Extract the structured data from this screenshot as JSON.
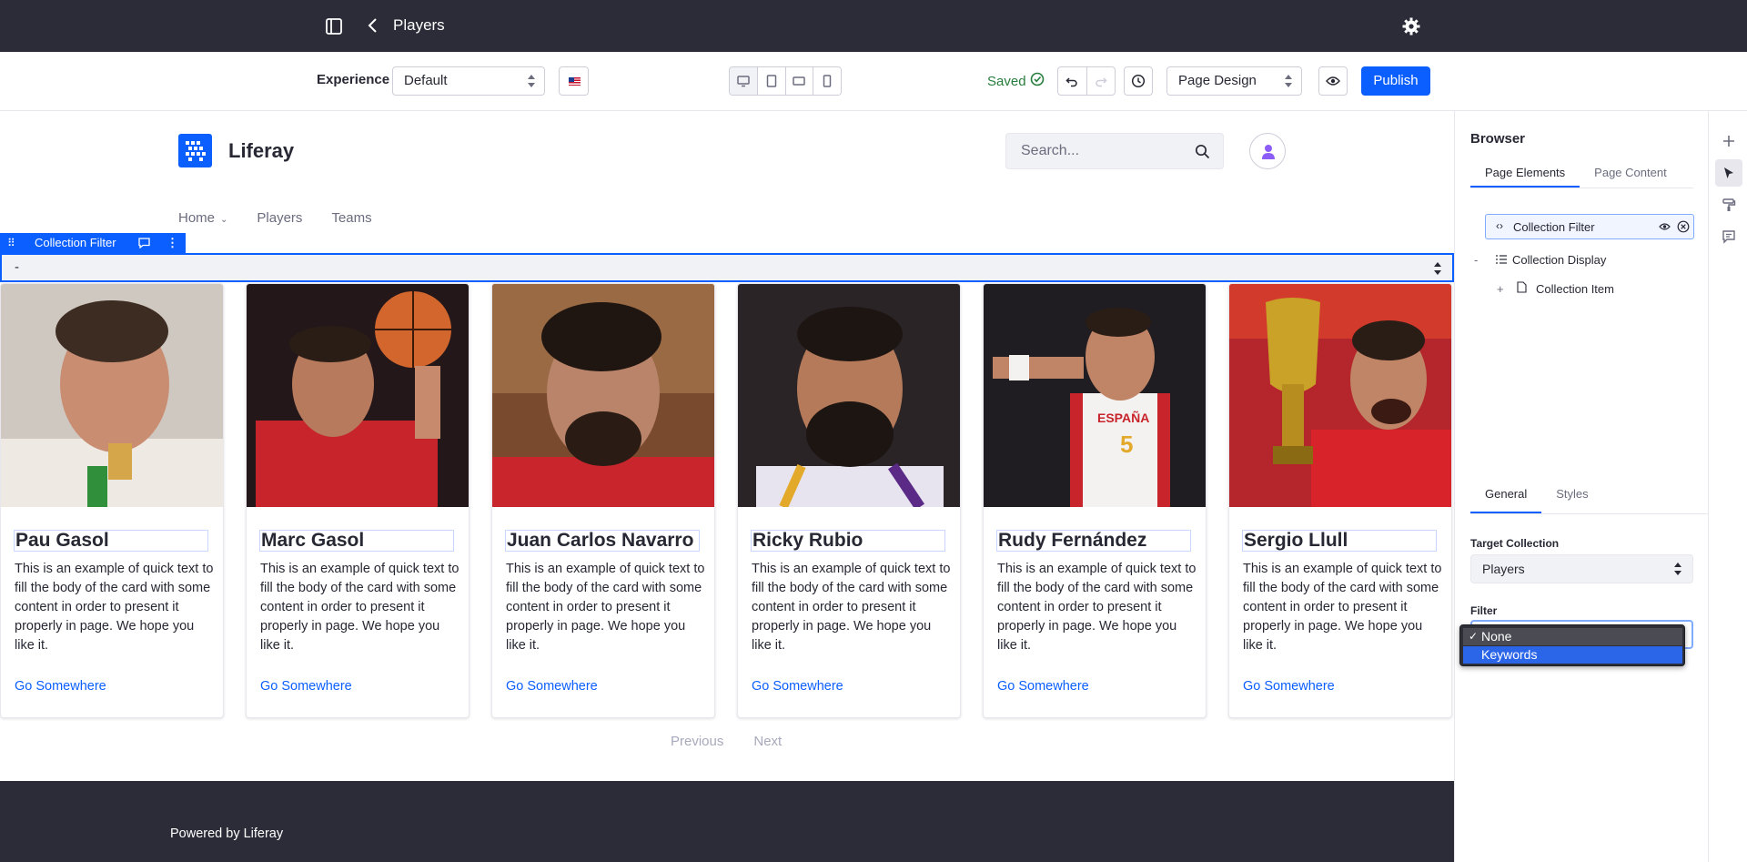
{
  "app": {
    "page_title": "Players"
  },
  "toolbar": {
    "experience_label": "Experience",
    "experience_value": "Default",
    "saved_label": "Saved",
    "mode_value": "Page Design",
    "publish_label": "Publish"
  },
  "site": {
    "logo_text": "Liferay",
    "search_placeholder": "Search...",
    "nav": [
      "Home",
      "Players",
      "Teams"
    ]
  },
  "collection_filter": {
    "tag_label": "Collection Filter",
    "value": "-"
  },
  "cards": [
    {
      "name": "Pau Gasol",
      "text": "This is an example of quick text to fill the body of the card with some content in order to present it properly in page. We hope you like it.",
      "link": "Go Somewhere"
    },
    {
      "name": "Marc Gasol",
      "text": "This is an example of quick text to fill the body of the card with some content in order to present it properly in page. We hope you like it.",
      "link": "Go Somewhere"
    },
    {
      "name": "Juan Carlos Navarro",
      "text": "This is an example of quick text to fill the body of the card with some content in order to present it properly in page. We hope you like it.",
      "link": "Go Somewhere"
    },
    {
      "name": "Ricky Rubio",
      "text": "This is an example of quick text to fill the body of the card with some content in order to present it properly in page. We hope you like it.",
      "link": "Go Somewhere"
    },
    {
      "name": "Rudy Fernández",
      "text": "This is an example of quick text to fill the body of the card with some content in order to present it properly in page. We hope you like it.",
      "link": "Go Somewhere"
    },
    {
      "name": "Sergio Llull",
      "text": "This is an example of quick text to fill the body of the card with some content in order to present it properly in page. We hope you like it.",
      "link": "Go Somewhere"
    }
  ],
  "pagination": {
    "previous": "Previous",
    "next": "Next"
  },
  "footer": {
    "text": "Powered by Liferay"
  },
  "panel": {
    "title": "Browser",
    "tabs": [
      "Page Elements",
      "Page Content"
    ],
    "tree": {
      "selected": "Collection Filter",
      "display": "Collection Display",
      "item": "Collection Item"
    },
    "config_tabs": [
      "General",
      "Styles"
    ],
    "target_collection_label": "Target Collection",
    "target_collection_value": "Players",
    "filter_label": "Filter",
    "filter_options": [
      "None",
      "Keywords"
    ]
  },
  "colors": {
    "primary": "#0b5fff",
    "dark_bar": "#2b2c38",
    "saved_green": "#287d3c"
  },
  "icons": [
    "sidebar-toggle-icon",
    "back-chevron-icon",
    "gear-icon",
    "desktop-icon",
    "tablet-icon",
    "landscape-icon",
    "mobile-icon",
    "check-circle-icon",
    "undo-icon",
    "redo-icon",
    "history-icon",
    "eye-icon",
    "search-icon",
    "user-icon",
    "plus-icon",
    "cursor-icon",
    "paint-roller-icon",
    "comment-icon"
  ]
}
